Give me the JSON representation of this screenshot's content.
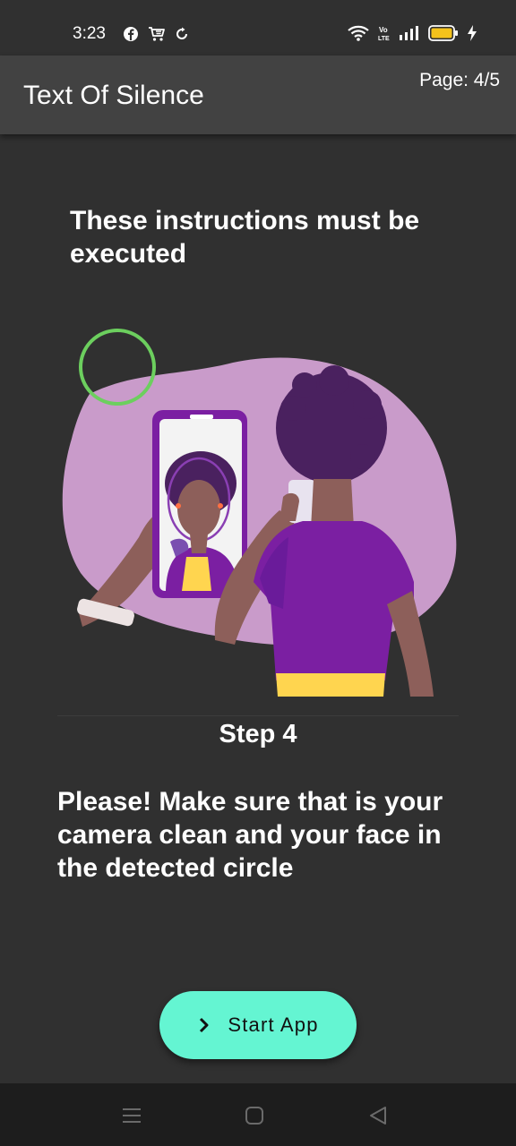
{
  "status_bar": {
    "time": "3:23",
    "left_icons": [
      "facebook-icon",
      "cart-icon",
      "sync-icon"
    ],
    "right_icons": [
      "wifi-icon",
      "volte-icon",
      "signal-icon",
      "battery-icon",
      "charging-icon"
    ],
    "battery_color": "#f4c21b"
  },
  "app_bar": {
    "title": "Text Of Silence",
    "page_indicator": "Page: 4/5"
  },
  "content": {
    "instructions": "These instructions must be executed",
    "step_label": "Step 4",
    "description": "Please! Make sure that is your camera clean and your face in the detected circle",
    "illustration": "person-taking-selfie-illustration"
  },
  "start_button": {
    "label": "Start App",
    "icon": "chevron-right-icon",
    "color": "#64f5d2"
  },
  "nav_bar": {
    "buttons": [
      "menu-icon",
      "home-icon",
      "back-icon"
    ]
  },
  "colors": {
    "background": "#303030",
    "app_bar": "#424242",
    "accent_purple": "#7b1fa2",
    "blob_lilac": "#c99bca",
    "detect_circle_green": "#6ccf5e"
  }
}
